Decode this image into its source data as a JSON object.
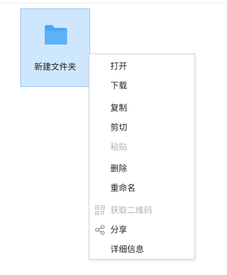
{
  "folder": {
    "name": "新建文件夹",
    "color": "#4aa6f6"
  },
  "context_menu": {
    "items": [
      {
        "label": "打开",
        "enabled": true
      },
      {
        "label": "下载",
        "enabled": true
      },
      {
        "label": "复制",
        "enabled": true
      },
      {
        "label": "剪切",
        "enabled": true
      },
      {
        "label": "粘贴",
        "enabled": false
      },
      {
        "label": "删除",
        "enabled": true
      },
      {
        "label": "重命名",
        "enabled": true
      },
      {
        "label": "获取二维码",
        "enabled": false,
        "icon": "qr-code-icon"
      },
      {
        "label": "分享",
        "enabled": true,
        "icon": "share-icon"
      },
      {
        "label": "详细信息",
        "enabled": true
      }
    ]
  }
}
